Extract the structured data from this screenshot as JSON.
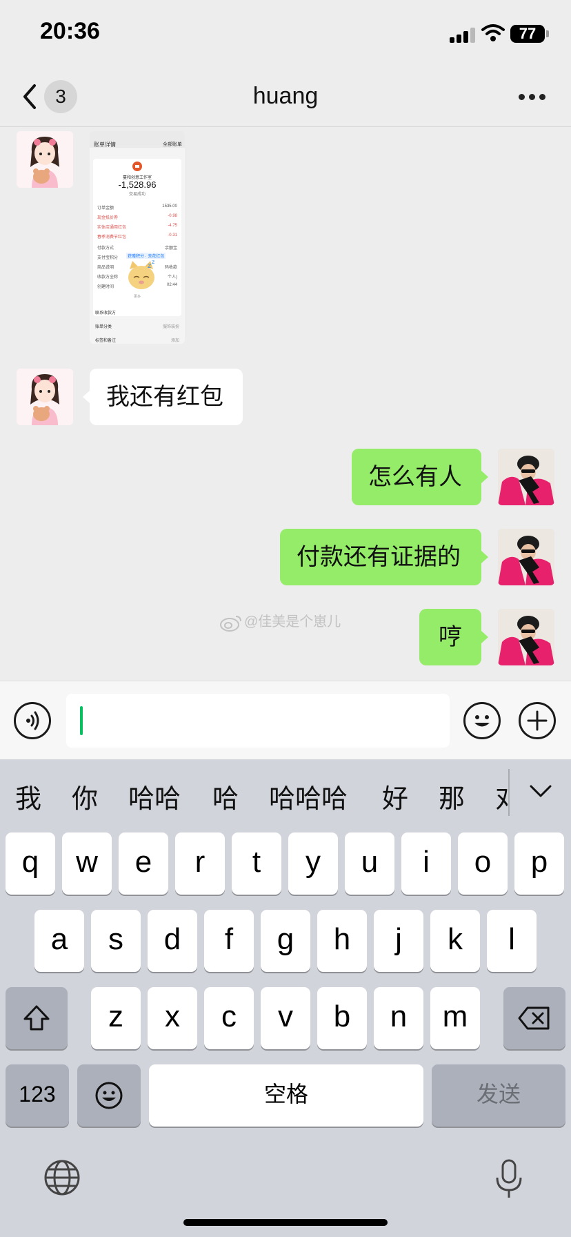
{
  "status_bar": {
    "time": "20:36",
    "battery": "77"
  },
  "nav": {
    "unread_count": "3",
    "title": "huang"
  },
  "receipt": {
    "header": "账单详情",
    "all_bills": "全部账单",
    "merchant": "蔓和创意工作室",
    "amount": "-1,528.96",
    "status": "交易成功",
    "rows": [
      {
        "label": "订单金额",
        "value": "1535.00"
      },
      {
        "label": "现金抵价券",
        "value": "-0.98"
      },
      {
        "label": "实体店通用红包",
        "value": "-4.75"
      },
      {
        "label": "春季消费节红包",
        "value": "-0.31"
      },
      {
        "label": "付款方式",
        "value": "余额宝"
      },
      {
        "label": "支付宝积分",
        "value": ""
      },
      {
        "label": "商品说明",
        "value": "码收款"
      },
      {
        "label": "收款方全称",
        "value": "个人)"
      },
      {
        "label": "创建时间",
        "value": "02:44"
      }
    ],
    "points_tag": "获赠积分 · 去花红包",
    "more": "更多",
    "footer": [
      {
        "label": "联系收款方",
        "value": ""
      },
      {
        "label": "账单分类",
        "value": "服饰装扮"
      },
      {
        "label": "标签和备注",
        "value": "添加"
      }
    ]
  },
  "messages": [
    {
      "direction": "in",
      "text": "我还有红包"
    },
    {
      "direction": "out",
      "text": "怎么有人"
    },
    {
      "direction": "out",
      "text": "付款还有证据的"
    },
    {
      "direction": "out",
      "text": "哼"
    }
  ],
  "watermark": "@佳美是个崽儿",
  "keyboard": {
    "candidates": [
      "我",
      "你",
      "哈哈",
      "哈",
      "哈哈哈",
      "好",
      "那",
      "对"
    ],
    "row1": [
      "q",
      "w",
      "e",
      "r",
      "t",
      "y",
      "u",
      "i",
      "o",
      "p"
    ],
    "row2": [
      "a",
      "s",
      "d",
      "f",
      "g",
      "h",
      "j",
      "k",
      "l"
    ],
    "row3": [
      "z",
      "x",
      "c",
      "v",
      "b",
      "n",
      "m"
    ],
    "numbers_key": "123",
    "space_key": "空格",
    "send_key": "发送"
  },
  "colors": {
    "background": "#ededed",
    "outgoing_bubble": "#95ec69",
    "incoming_bubble": "#ffffff",
    "caret": "#07c160",
    "keyboard_bg": "#d1d4db"
  },
  "icons": [
    "back-icon",
    "more-icon",
    "voice-icon",
    "emoji-icon",
    "plus-icon",
    "shift-icon",
    "delete-icon",
    "globe-icon",
    "mic-icon",
    "chevron-down-icon"
  ]
}
